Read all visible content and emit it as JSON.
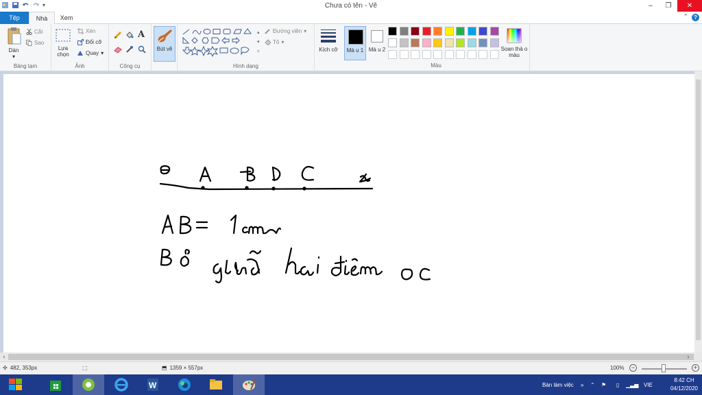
{
  "window": {
    "title": "Chưa có tên - Vẽ",
    "controls": {
      "minimize": "–",
      "maximize": "❐",
      "close": "✕"
    }
  },
  "tabs": {
    "file": "Tệp",
    "home": "Nhà",
    "view": "Xem"
  },
  "ribbon": {
    "clipboard": {
      "paste": "Dán",
      "cut": "Cắt",
      "copy": "Sao",
      "label": "Bảng tạm"
    },
    "image": {
      "select": "Lựa chọn",
      "crop": "Xén",
      "resize": "Đổi cỡ",
      "rotate": "Quay",
      "label": "Ảnh"
    },
    "tools": {
      "label": "Công cụ",
      "text_tool": "A"
    },
    "brushes": {
      "label": "Bút vẽ"
    },
    "shapes": {
      "outline": "Đường viền",
      "fill": "Tô",
      "label": "Hình dạng"
    },
    "size": {
      "label": "Kích cỡ"
    },
    "color1": {
      "label": "Mà u 1"
    },
    "color2": {
      "label": "Mà u 2"
    },
    "edit_colors": {
      "label": "Soan thả o màu"
    },
    "colors_group": {
      "label": "Màu"
    },
    "palette_row1": [
      "#000000",
      "#7f7f7f",
      "#880015",
      "#ed1c24",
      "#ff7f27",
      "#fff200",
      "#22b14c",
      "#00a2e8",
      "#3f48cc",
      "#a349a4"
    ],
    "palette_row2": [
      "#ffffff",
      "#c3c3c3",
      "#b97a57",
      "#ffaec9",
      "#ffc90e",
      "#efe4b0",
      "#b5e61d",
      "#99d9ea",
      "#7092be",
      "#c8bfe7"
    ],
    "palette_row3": [
      "#ffffff",
      "#ffffff",
      "#ffffff",
      "#ffffff",
      "#ffffff",
      "#ffffff",
      "#ffffff",
      "#ffffff",
      "#ffffff",
      "#ffffff"
    ]
  },
  "statusbar": {
    "cursor_pos": "482, 353px",
    "image_size": "1359 × 557px",
    "zoom": "100%"
  },
  "taskbar": {
    "tray_label": "Bàn làm việc",
    "language": "VIE",
    "time": "8:42 CH",
    "date": "04/12/2020"
  }
}
